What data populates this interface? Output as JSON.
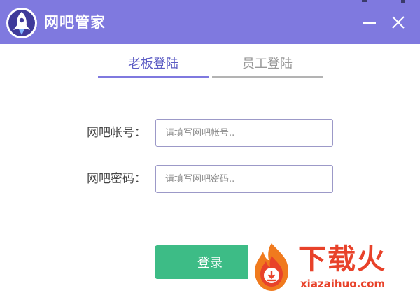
{
  "app": {
    "title": "网吧管家",
    "colors": {
      "titlebar": "#7f79df",
      "accent": "#5c5cc4",
      "login": "#3dbc86"
    }
  },
  "window_controls": {
    "minimize_icon": "minimize-icon",
    "close_icon": "close-icon"
  },
  "tabs": [
    {
      "label": "老板登陆",
      "active": true
    },
    {
      "label": "员工登陆",
      "active": false
    }
  ],
  "form": {
    "account": {
      "label": "网吧帐号：",
      "placeholder": "请填写网吧帐号..",
      "value": ""
    },
    "password": {
      "label": "网吧密码：",
      "placeholder": "请填写网吧密码..",
      "value": ""
    },
    "login_label": "登录"
  },
  "watermark": {
    "brand": "下载火",
    "url": "xiazaihuo.com"
  }
}
